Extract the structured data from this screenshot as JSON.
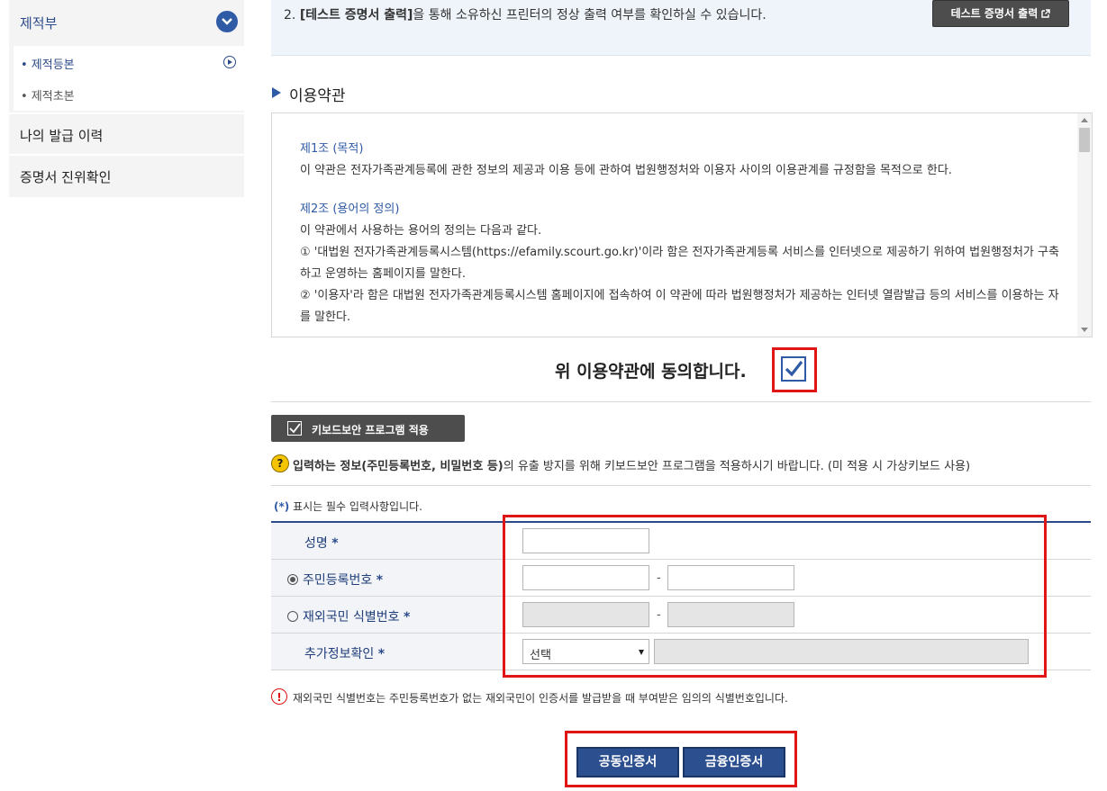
{
  "sidebar": {
    "heading": "제적부",
    "sub_items": [
      {
        "label": "• 제적등본"
      },
      {
        "label": "• 제적초본"
      }
    ],
    "items": [
      {
        "label": "나의 발급 이력"
      },
      {
        "label": "증명서 진위확인"
      }
    ]
  },
  "notice": {
    "prefix": "2. ",
    "bold": "[테스트 증명서 출력]",
    "rest": "을 통해 소유하신 프린터의 정상 출력 여부를 확인하실 수 있습니다.",
    "button_label": "테스트 증명서 출력",
    "button_icon": "external-link-icon"
  },
  "terms": {
    "section_title": "이용약관",
    "articles": [
      {
        "title": "제1조 (목적)",
        "lines": [
          "이 약관은 전자가족관계등록에 관한 정보의 제공과 이용 등에 관하여 법원행정처와 이용자 사이의 이용관계를 규정함을 목적으로 한다."
        ]
      },
      {
        "title": "제2조 (용어의 정의)",
        "lines": [
          "이 약관에서 사용하는 용어의 정의는 다음과 같다.",
          "① '대법원 전자가족관계등록시스템(https://efamily.scourt.go.kr)'이라 함은 전자가족관계등록 서비스를 인터넷으로 제공하기 위하여 법원행정처가 구축하고 운영하는 홈페이지를 말한다.",
          "② '이용자'라 함은 대법원 전자가족관계등록시스템 홈페이지에 접속하여 이 약관에 따라 법원행정처가 제공하는 인터넷 열람발급 등의 서비스를 이용하는 자를 말한다."
        ]
      }
    ],
    "agree_label": "위 이용약관에 동의합니다."
  },
  "security": {
    "keyboard_button": "키보드보안 프로그램 적용",
    "info_bold": "입력하는 정보(주민등록번호, 비밀번호 등)",
    "info_rest": "의 유출 방지를 위해 키보드보안 프로그램을 적용하시기 바랍니다. (미 적용 시 가상키보드 사용)"
  },
  "form": {
    "required_mark": "(*)",
    "required_note": " 표시는 필수 입력사항입니다.",
    "rows": [
      {
        "label": "성명"
      },
      {
        "label": "주민등록번호"
      },
      {
        "label": "재외국민 식별번호"
      },
      {
        "label": "추가정보확인"
      }
    ],
    "star": "*",
    "dash": "-",
    "select_value": "선택"
  },
  "warning": "재외국민 식별번호는 주민등록번호가 없는 재외국민이 인증서를 발급받을 때 부여받은 임의의 식별번호입니다.",
  "buttons": {
    "joint_cert": "공동인증서",
    "finance_cert": "금융인증서"
  },
  "colors": {
    "accent": "#2f5aa6",
    "highlight": "#e01515",
    "button_dark": "#4d4d4d",
    "button_blue": "#2c4f8f"
  }
}
